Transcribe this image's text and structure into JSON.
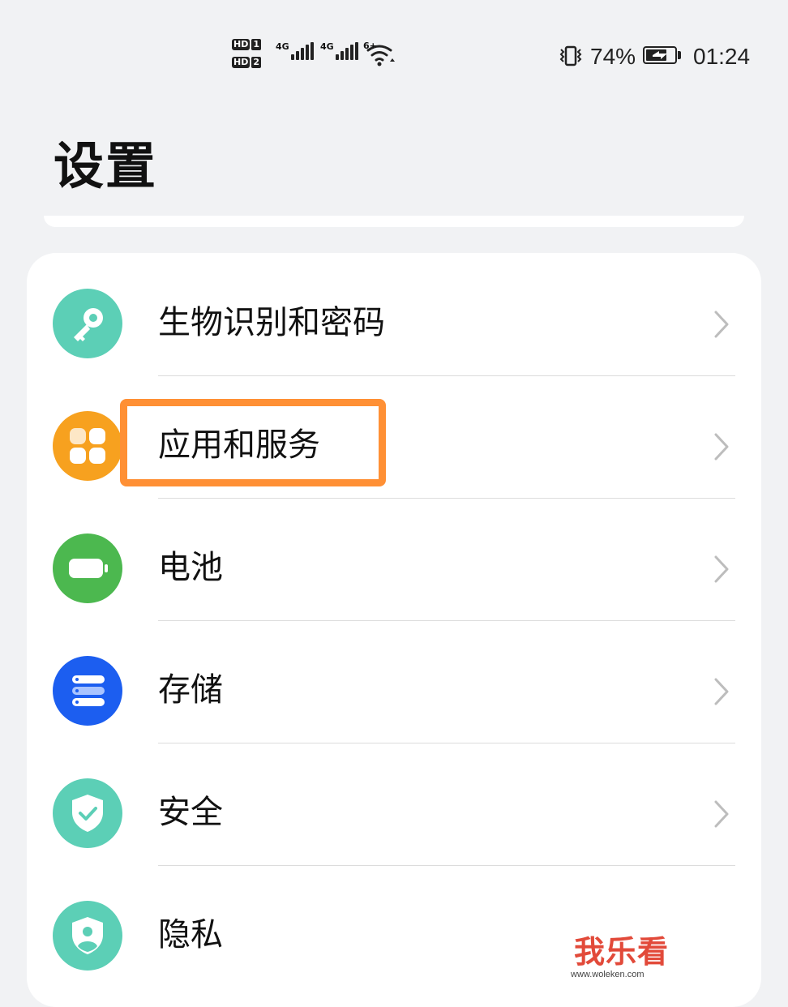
{
  "status_bar": {
    "sim1_badge": "HD",
    "sim1_number": "1",
    "sim2_badge": "HD",
    "sim2_number": "2",
    "network1": "4G",
    "network2": "4G",
    "wifi_label": "6+",
    "battery_percent": "74%",
    "battery_level": 0.74,
    "time": "01:24",
    "icons": [
      "hd-icon",
      "signal-icon",
      "signal-icon",
      "wifi-icon",
      "vibrate-icon",
      "battery-charging-icon"
    ]
  },
  "header": {
    "title": "设置"
  },
  "settings": {
    "items": [
      {
        "label": "生物识别和密码",
        "icon": "key-icon",
        "color": "#5ccfb6"
      },
      {
        "label": "应用和服务",
        "icon": "apps-icon",
        "color": "#f7a11f"
      },
      {
        "label": "电池",
        "icon": "battery-icon",
        "color": "#4cb84f"
      },
      {
        "label": "存储",
        "icon": "storage-icon",
        "color": "#1c5ef0"
      },
      {
        "label": "安全",
        "icon": "shield-check-icon",
        "color": "#5ccfb6"
      },
      {
        "label": "隐私",
        "icon": "privacy-icon",
        "color": "#5ccfb6"
      }
    ]
  },
  "annotation": {
    "highlight_color": "#ff9035",
    "highlighted_item": "应用和服务"
  },
  "watermark": {
    "logo": "我乐看",
    "url": "www.woleken.com",
    "color": "#e24a3a"
  }
}
